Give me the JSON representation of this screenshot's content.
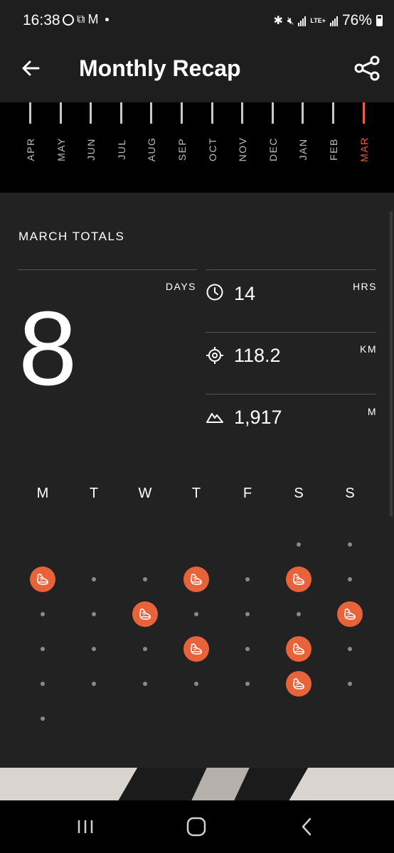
{
  "status": {
    "time": "16:38",
    "network": "LTE+",
    "battery": "76%"
  },
  "header": {
    "title": "Monthly Recap",
    "back_icon": "arrow-left-icon",
    "share_icon": "share-icon"
  },
  "months": [
    {
      "label": "APR",
      "active": false
    },
    {
      "label": "MAY",
      "active": false
    },
    {
      "label": "JUN",
      "active": false
    },
    {
      "label": "JUL",
      "active": false
    },
    {
      "label": "AUG",
      "active": false
    },
    {
      "label": "SEP",
      "active": false
    },
    {
      "label": "OCT",
      "active": false
    },
    {
      "label": "NOV",
      "active": false
    },
    {
      "label": "DEC",
      "active": false
    },
    {
      "label": "JAN",
      "active": false
    },
    {
      "label": "FEB",
      "active": false
    },
    {
      "label": "MAR",
      "active": true
    }
  ],
  "totals": {
    "title": "MARCH TOTALS",
    "days_label": "DAYS",
    "days": "8",
    "stats": [
      {
        "icon": "clock-icon",
        "value": "14",
        "unit": "HRS"
      },
      {
        "icon": "target-icon",
        "value": "118.2",
        "unit": "KM"
      },
      {
        "icon": "mountain-icon",
        "value": "1,917",
        "unit": "M"
      }
    ]
  },
  "calendar": {
    "weekdays": [
      "M",
      "T",
      "W",
      "T",
      "F",
      "S",
      "S"
    ],
    "weeks": [
      [
        null,
        null,
        null,
        null,
        null,
        "day",
        "day"
      ],
      [
        "run",
        "day",
        "day",
        "run",
        "day",
        "run",
        "day"
      ],
      [
        "day",
        "day",
        "run",
        "day",
        "day",
        "day",
        "run"
      ],
      [
        "day",
        "day",
        "day",
        "run",
        "day",
        "run",
        "day"
      ],
      [
        "day",
        "day",
        "day",
        "day",
        "day",
        "run",
        "day"
      ],
      [
        "day",
        null,
        null,
        null,
        null,
        null,
        null
      ]
    ]
  },
  "colors": {
    "accent": "#e8623a",
    "card": "#222222",
    "bar": "#1e1e1e"
  }
}
